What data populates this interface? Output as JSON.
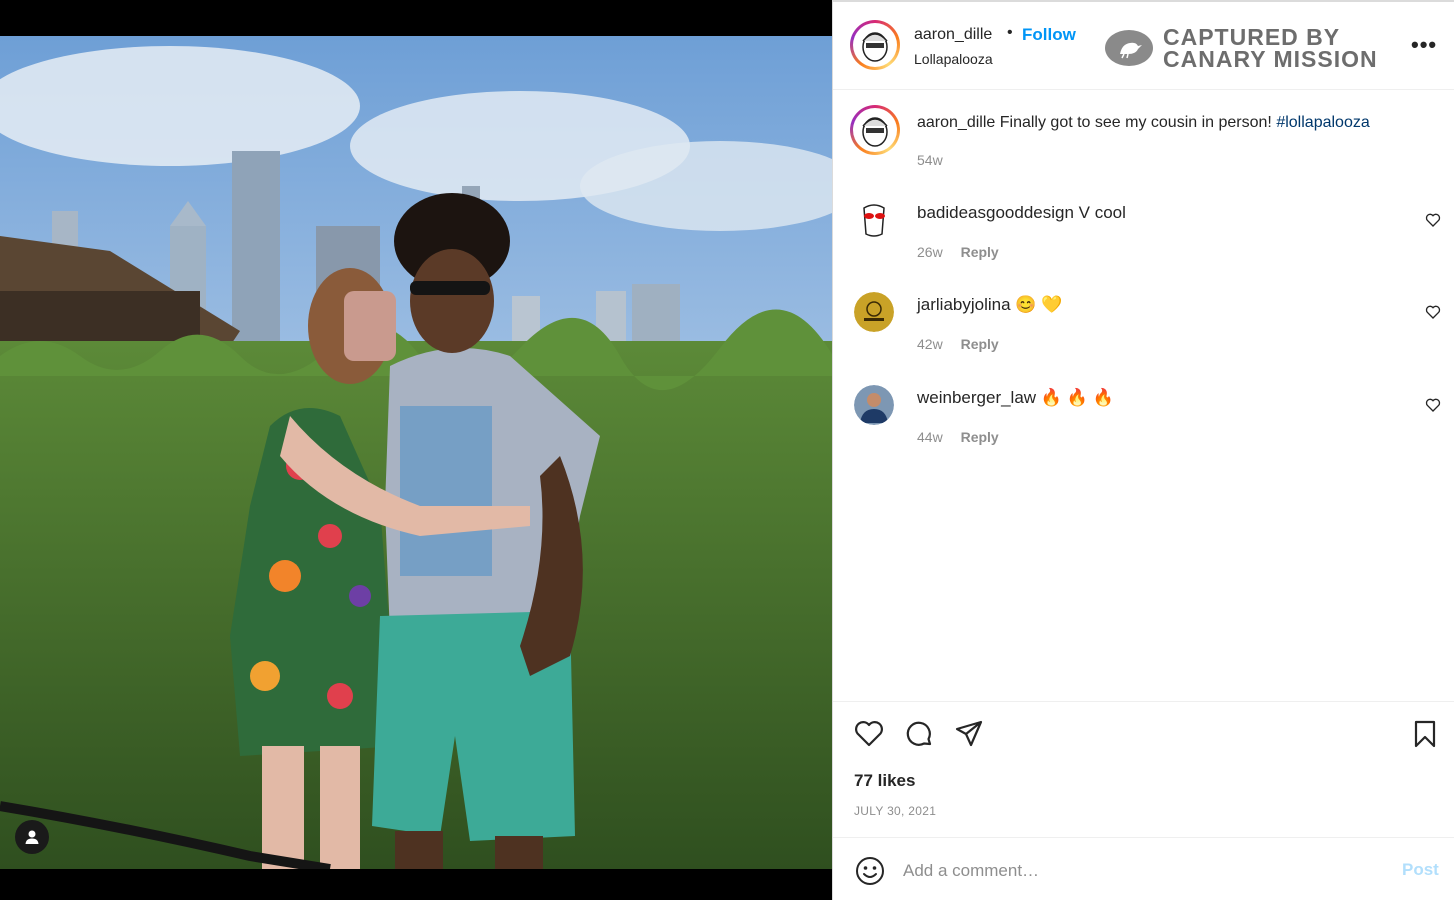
{
  "post": {
    "username": "aaron_dille",
    "follow_label": "Follow",
    "location": "Lollapalooza",
    "separator": "•",
    "more_label": "•••",
    "watermark_line1": "CAPTURED BY",
    "watermark_line2": "CANARY MISSION"
  },
  "caption": {
    "username": "aaron_dille",
    "text": "Finally got to see my cousin in person!",
    "hashtag": "#lollapalooza",
    "time": "54w"
  },
  "comments": [
    {
      "username": "badideasgooddesign",
      "text": "V cool",
      "time": "26w",
      "reply": "Reply"
    },
    {
      "username": "jarliabyjolina",
      "text": "😊 💛",
      "time": "42w",
      "reply": "Reply"
    },
    {
      "username": "weinberger_law",
      "text": "🔥 🔥 🔥",
      "time": "44w",
      "reply": "Reply"
    }
  ],
  "likes": "77 likes",
  "date": "JULY 30, 2021",
  "comment_box": {
    "placeholder": "Add a comment…",
    "post_label": "Post"
  },
  "colors": {
    "accent": "#0095f6",
    "hashtag": "#00376b",
    "muted": "#8e8e8e",
    "post_disabled": "#b2dffc"
  }
}
